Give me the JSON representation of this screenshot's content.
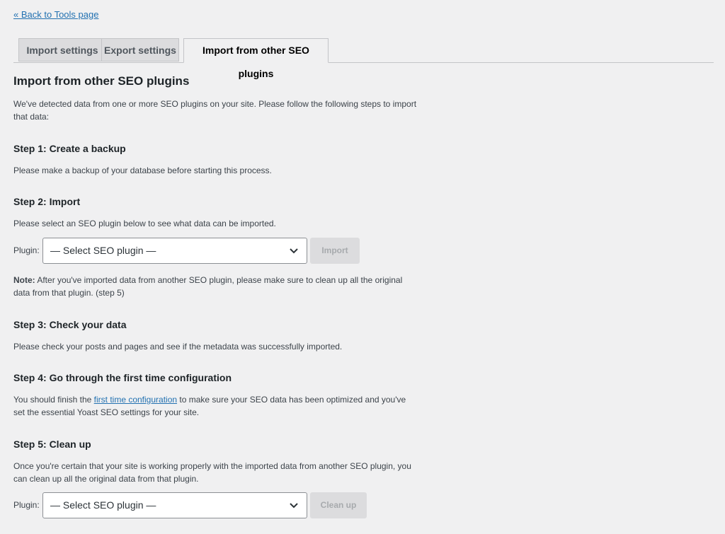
{
  "back_link": "« Back to Tools page",
  "tabs": [
    {
      "label": "Import settings"
    },
    {
      "label": "Export settings"
    },
    {
      "label": "Import from other SEO plugins"
    }
  ],
  "main": {
    "title": "Import from other SEO plugins",
    "intro": "We've detected data from one or more SEO plugins on your site. Please follow the following steps to import that data:",
    "step1": {
      "heading": "Step 1: Create a backup",
      "text": "Please make a backup of your database before starting this process."
    },
    "step2": {
      "heading": "Step 2: Import",
      "text": "Please select an SEO plugin below to see what data can be imported.",
      "plugin_label": "Plugin:",
      "select_value": "— Select SEO plugin —",
      "button": "Import",
      "note_label": "Note:",
      "note_text": " After you've imported data from another SEO plugin, please make sure to clean up all the original data from that plugin. (step 5)"
    },
    "step3": {
      "heading": "Step 3: Check your data",
      "text": "Please check your posts and pages and see if the metadata was successfully imported."
    },
    "step4": {
      "heading": "Step 4: Go through the first time configuration",
      "text_before": "You should finish the ",
      "link": "first time configuration",
      "text_after": " to make sure your SEO data has been optimized and you've set the essential Yoast SEO settings for your site."
    },
    "step5": {
      "heading": "Step 5: Clean up",
      "text": "Once you're certain that your site is working properly with the imported data from another SEO plugin, you can clean up all the original data from that plugin.",
      "plugin_label": "Plugin:",
      "select_value": "— Select SEO plugin —",
      "button": "Clean up"
    }
  },
  "icons": {
    "select_chevron": "chevron-down-icon"
  }
}
